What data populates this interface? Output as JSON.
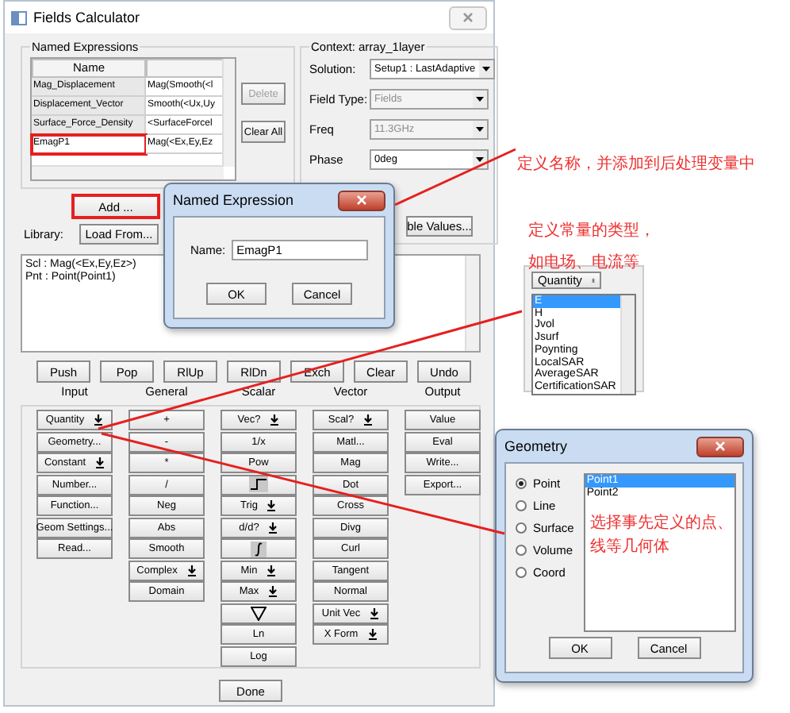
{
  "window": {
    "title": "Fields Calculator"
  },
  "named_expressions": {
    "title": "Named Expressions",
    "columns": [
      "Name"
    ],
    "rows": [
      {
        "name": "Mag_Displacement",
        "expression": "Mag(Smooth(<l",
        "highlighted": false
      },
      {
        "name": "Displacement_Vector",
        "expression": "Smooth(<Ux,Uy",
        "highlighted": false
      },
      {
        "name": "Surface_Force_Density",
        "expression": "<SurfaceForcel",
        "highlighted": false
      },
      {
        "name": "EmagP1",
        "expression": "Mag(<Ex,Ey,Ez",
        "highlighted": true
      }
    ]
  },
  "side_buttons": [
    {
      "label": "Delete",
      "disabled": true
    },
    {
      "label": "Clear All",
      "disabled": false
    }
  ],
  "context": {
    "title": "Context: array_1layer",
    "fields": [
      {
        "label": "Solution:",
        "value": "Setup1 : LastAdaptive",
        "disabled": false
      },
      {
        "label": "Field Type:",
        "value": "Fields",
        "disabled": true
      },
      {
        "label": "Freq",
        "value": "11.3GHz",
        "disabled": true
      },
      {
        "label": "Phase",
        "value": "0deg",
        "disabled": false
      }
    ]
  },
  "add_button": {
    "label": "Add ...",
    "highlighted": true
  },
  "library": {
    "label": "Library:",
    "button": "Load From..."
  },
  "variable_values_button": "ble Values...",
  "stack": [
    "Scl : Mag(<Ex,Ey,Ez>)",
    "Pnt : Point(Point1)"
  ],
  "stack_buttons": [
    "Push",
    "Pop",
    "RlUp",
    "RlDn",
    "Exch",
    "Clear",
    "Undo"
  ],
  "groups": [
    {
      "title": "Input",
      "buttons": [
        {
          "kind": "dropdown",
          "label": "Quantity"
        },
        {
          "kind": "text",
          "label": "Geometry..."
        },
        {
          "kind": "dropdown",
          "label": "Constant"
        },
        {
          "kind": "text",
          "label": "Number..."
        },
        {
          "kind": "text",
          "label": "Function..."
        },
        {
          "kind": "text",
          "label": "Geom Settings..."
        },
        {
          "kind": "text",
          "label": "Read..."
        }
      ]
    },
    {
      "title": "General",
      "buttons": [
        {
          "kind": "text",
          "label": "+"
        },
        {
          "kind": "text",
          "label": "-"
        },
        {
          "kind": "text",
          "label": "*"
        },
        {
          "kind": "text",
          "label": "/"
        },
        {
          "kind": "text",
          "label": "Neg"
        },
        {
          "kind": "text",
          "label": "Abs"
        },
        {
          "kind": "text",
          "label": "Smooth"
        },
        {
          "kind": "dropdown",
          "label": "Complex"
        },
        {
          "kind": "text",
          "label": "Domain"
        }
      ]
    },
    {
      "title": "Scalar",
      "buttons": [
        {
          "kind": "dropdown",
          "label": "Vec?"
        },
        {
          "kind": "text",
          "label": "1/x"
        },
        {
          "kind": "text",
          "label": "Pow"
        },
        {
          "kind": "step"
        },
        {
          "kind": "dropdown",
          "label": "Trig"
        },
        {
          "kind": "dropdown",
          "label": "d/d?"
        },
        {
          "kind": "integral"
        },
        {
          "kind": "dropdown",
          "label": "Min"
        },
        {
          "kind": "dropdown",
          "label": "Max"
        },
        {
          "kind": "nabla"
        },
        {
          "kind": "text",
          "label": "Ln"
        },
        {
          "kind": "text",
          "label": "Log"
        }
      ]
    },
    {
      "title": "Vector",
      "buttons": [
        {
          "kind": "dropdown",
          "label": "Scal?"
        },
        {
          "kind": "text",
          "label": "Matl..."
        },
        {
          "kind": "text",
          "label": "Mag"
        },
        {
          "kind": "text",
          "label": "Dot"
        },
        {
          "kind": "text",
          "label": "Cross"
        },
        {
          "kind": "text",
          "label": "Divg"
        },
        {
          "kind": "text",
          "label": "Curl"
        },
        {
          "kind": "text",
          "label": "Tangent"
        },
        {
          "kind": "text",
          "label": "Normal"
        },
        {
          "kind": "dropdown",
          "label": "Unit Vec"
        },
        {
          "kind": "dropdown",
          "label": "X Form"
        }
      ]
    },
    {
      "title": "Output",
      "buttons": [
        {
          "kind": "text",
          "label": "Value"
        },
        {
          "kind": "text",
          "label": "Eval"
        },
        {
          "kind": "text",
          "label": "Write..."
        },
        {
          "kind": "text",
          "label": "Export..."
        }
      ]
    }
  ],
  "done_button": "Done",
  "named_expression_dialog": {
    "title": "Named Expression",
    "name_label": "Name:",
    "name_value": "EmagP1",
    "buttons": [
      "OK",
      "Cancel"
    ]
  },
  "quantity_popup": {
    "button": "Quantity",
    "items": [
      {
        "label": "E",
        "selected": true
      },
      {
        "label": "H",
        "selected": false
      },
      {
        "label": "Jvol",
        "selected": false
      },
      {
        "label": "Jsurf",
        "selected": false
      },
      {
        "label": "Poynting",
        "selected": false
      },
      {
        "label": "LocalSAR",
        "selected": false
      },
      {
        "label": "AverageSAR",
        "selected": false
      },
      {
        "label": "CertificationSAR",
        "selected": false
      }
    ]
  },
  "geometry_dialog": {
    "title": "Geometry",
    "options": [
      {
        "label": "Point",
        "selected": true
      },
      {
        "label": "Line",
        "selected": false
      },
      {
        "label": "Surface",
        "selected": false
      },
      {
        "label": "Volume",
        "selected": false
      },
      {
        "label": "Coord",
        "selected": false
      }
    ],
    "items": [
      {
        "label": "Point1",
        "selected": true
      },
      {
        "label": "Point2",
        "selected": false
      }
    ],
    "note": [
      "选择事先定义的点、",
      "线等几何体"
    ],
    "buttons": [
      "OK",
      "Cancel"
    ]
  },
  "annotations": [
    {
      "lines": [
        "定义名称，并添加到后处理变量中"
      ]
    },
    {
      "lines": [
        "定义常量的类型，",
        "如电场、电流等"
      ]
    }
  ]
}
